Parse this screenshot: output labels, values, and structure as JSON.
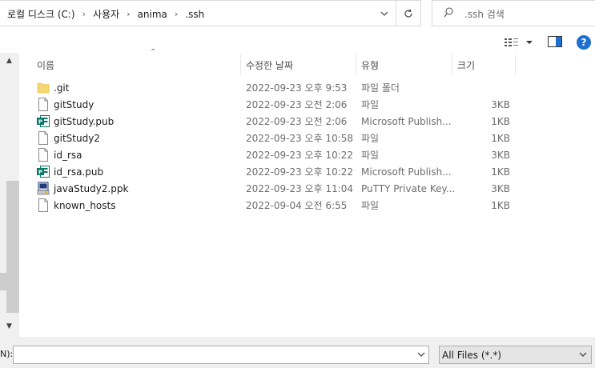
{
  "address": {
    "crumbs": [
      "로컬 디스크 (C:)",
      "사용자",
      "anima",
      ".ssh"
    ],
    "separator": "›"
  },
  "search": {
    "placeholder": ".ssh 검색"
  },
  "toolbar": {
    "help_label": "?"
  },
  "columns": {
    "name": "이름",
    "date": "수정한 날짜",
    "type": "유형",
    "size": "크기"
  },
  "files": [
    {
      "name": ".git",
      "date": "2022-09-23 오후 9:53",
      "type": "파일 폴더",
      "size": "",
      "icon": "folder-icon"
    },
    {
      "name": "gitStudy",
      "date": "2022-09-23 오전 2:06",
      "type": "파일",
      "size": "3KB",
      "icon": "file-icon"
    },
    {
      "name": "gitStudy.pub",
      "date": "2022-09-23 오전 2:06",
      "type": "Microsoft Publish...",
      "size": "1KB",
      "icon": "publisher-icon"
    },
    {
      "name": "gitStudy2",
      "date": "2022-09-23 오후 10:58",
      "type": "파일",
      "size": "1KB",
      "icon": "file-icon"
    },
    {
      "name": "id_rsa",
      "date": "2022-09-23 오후 10:22",
      "type": "파일",
      "size": "3KB",
      "icon": "file-icon"
    },
    {
      "name": "id_rsa.pub",
      "date": "2022-09-23 오후 10:22",
      "type": "Microsoft Publish...",
      "size": "1KB",
      "icon": "publisher-icon"
    },
    {
      "name": "javaStudy2.ppk",
      "date": "2022-09-23 오후 11:04",
      "type": "PuTTY Private Key...",
      "size": "3KB",
      "icon": "putty-key-icon"
    },
    {
      "name": "known_hosts",
      "date": "2022-09-04 오전 6:55",
      "type": "파일",
      "size": "1KB",
      "icon": "file-icon"
    }
  ],
  "bottom": {
    "filename_label": "N):",
    "filename_value": "",
    "filter_value": "All Files (*.*)"
  },
  "colors": {
    "accent": "#1f6fd1",
    "folder": "#f5d774",
    "publisher": "#077568"
  }
}
